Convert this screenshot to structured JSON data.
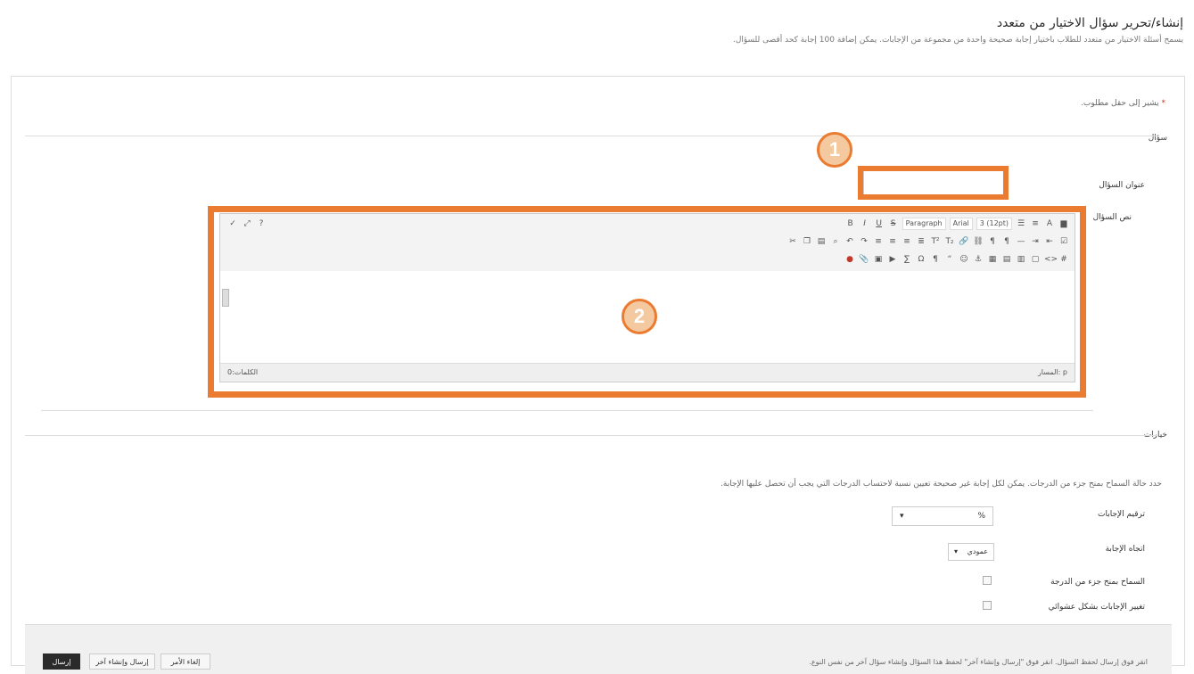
{
  "header": {
    "title": "إنشاء/تحرير سؤال الاختيار من متعدد",
    "subtitle": "يسمح أسئلة الاختيار من متعدد للطلاب باختيار إجابة صحيحة واحدة من مجموعة من الإجابات. يمكن إضافة 100 إجابة كحد أقصى للسؤال."
  },
  "form": {
    "required_note": "يشير إلى حقل مطلوب.",
    "required_star": "*",
    "question_section": "سؤال",
    "question_title_label": "عنوان السؤال",
    "question_title_value": "",
    "question_text_label": "نص السؤال"
  },
  "editor": {
    "font_family": "Arial",
    "font_size": "3 (12pt)",
    "format": "Paragraph",
    "status_path": "المسار: p",
    "word_count": "الكلمات:0",
    "toolbar_row1_icons": [
      "bold-icon",
      "italic-icon",
      "underline-icon",
      "strikethrough-icon",
      "align-right-icon",
      "align-center-icon",
      "align-left-icon",
      "align-justify-icon",
      "bullet-list-icon",
      "number-list-icon",
      "indent-icon",
      "outdent-icon"
    ],
    "toolbar_row2_icons": [
      "cut-icon",
      "copy-icon",
      "paste-icon",
      "undo-icon",
      "redo-icon",
      "link-icon",
      "unlink-icon",
      "table-icon",
      "image-icon",
      "spellcheck-icon"
    ],
    "toolbar_row3_icons": [
      "mashup-icon",
      "attach-icon",
      "media-icon",
      "equation-icon",
      "symbol-icon",
      "html-icon",
      "css-icon",
      "fullscreen-icon"
    ]
  },
  "options": {
    "section": "خيارات",
    "instruction": "حدد حالة السماح بمنح جزء من الدرجات. يمكن لكل إجابة غير صحيحة تعيين نسبة لاحتساب الدرجات التي يجب أن تحصل عليها الإجابة.",
    "numbering_label": "ترقيم الإجابات",
    "numbering_value": "",
    "percent_sign": "%",
    "orientation_label": "اتجاه الإجابة",
    "orientation_value": "عمودي",
    "partial_credit_label": "السماح بمنح جزء من الدرجة",
    "randomize_label": "تغيير الإجابات بشكل عشوائي"
  },
  "footer": {
    "hint": "انقر فوق إرسال لحفظ السؤال. انقر فوق \"إرسال وإنشاء آخر\" لحفظ هذا السؤال وإنشاء سؤال آخر من نفس النوع.",
    "cancel_label": "إلغاء الأمر",
    "submit_another_label": "إرسال وإنشاء آخر",
    "submit_label": "إرسال"
  },
  "callouts": {
    "one": "1",
    "two": "2"
  },
  "colors": {
    "callout": "#ea7b30",
    "callout_fill": "#f5c9a0"
  }
}
